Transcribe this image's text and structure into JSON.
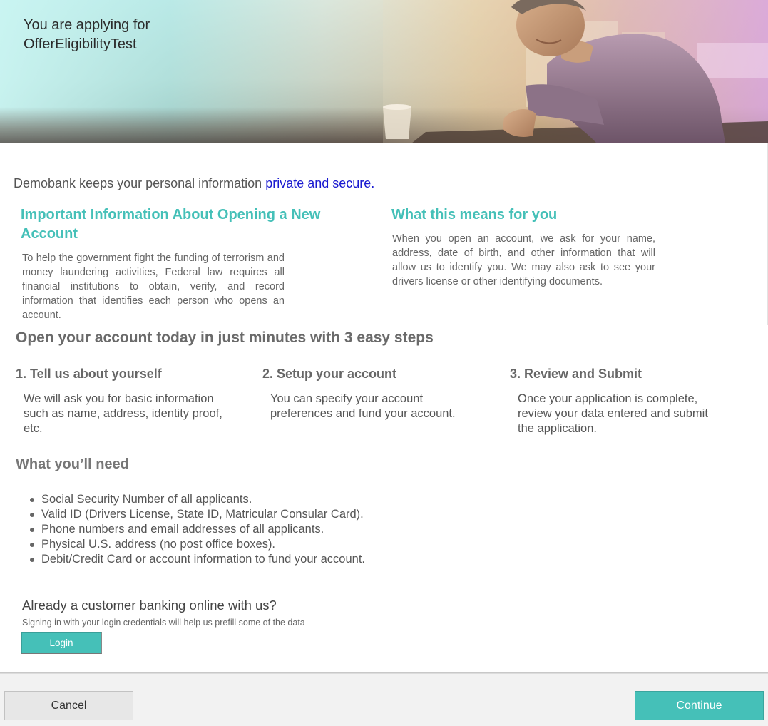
{
  "hero": {
    "title_line1": "You are applying for",
    "title_line2": "OfferEligibilityTest"
  },
  "privacy": {
    "text": "Demobank keeps your personal information ",
    "link": "private and secure",
    "suffix": "."
  },
  "important": {
    "title": "Important Information About Opening a New Account",
    "body": "To help the government fight the funding of terrorism and money laundering activities, Federal law requires all financial institutions to obtain, verify, and record information that identifies each person who opens an account."
  },
  "means": {
    "title": "What this means for you",
    "body": "When you open an account, we ask for your name, address, date of birth, and other information that will allow us to identify you. We may also ask to see your drivers license or other identifying documents."
  },
  "steps": {
    "heading": "Open your account today in just minutes with 3 easy steps",
    "items": [
      {
        "title": "1. Tell us about yourself",
        "body": "We will ask you for basic information such as name, address, identity proof, etc."
      },
      {
        "title": "2. Setup your account",
        "body": "You can specify your account preferences and fund your account."
      },
      {
        "title": "3. Review and Submit",
        "body": "Once your application is complete, review your data entered and submit the application."
      }
    ]
  },
  "need": {
    "heading": "What you’ll need",
    "items": [
      "Social Security Number of all applicants.",
      "Valid ID (Drivers License, State ID, Matricular Consular Card).",
      "Phone numbers and email addresses of all applicants.",
      "Physical U.S. address (no post office boxes).",
      "Debit/Credit Card or account information to fund your account."
    ]
  },
  "existing": {
    "heading": "Already a customer banking online with us?",
    "subtext": "Signing in with your login credentials will help us prefill some of the data",
    "login_label": "Login"
  },
  "footer": {
    "cancel_label": "Cancel",
    "continue_label": "Continue"
  },
  "colors": {
    "accent": "#45c0b8",
    "link": "#1a1ad0"
  }
}
